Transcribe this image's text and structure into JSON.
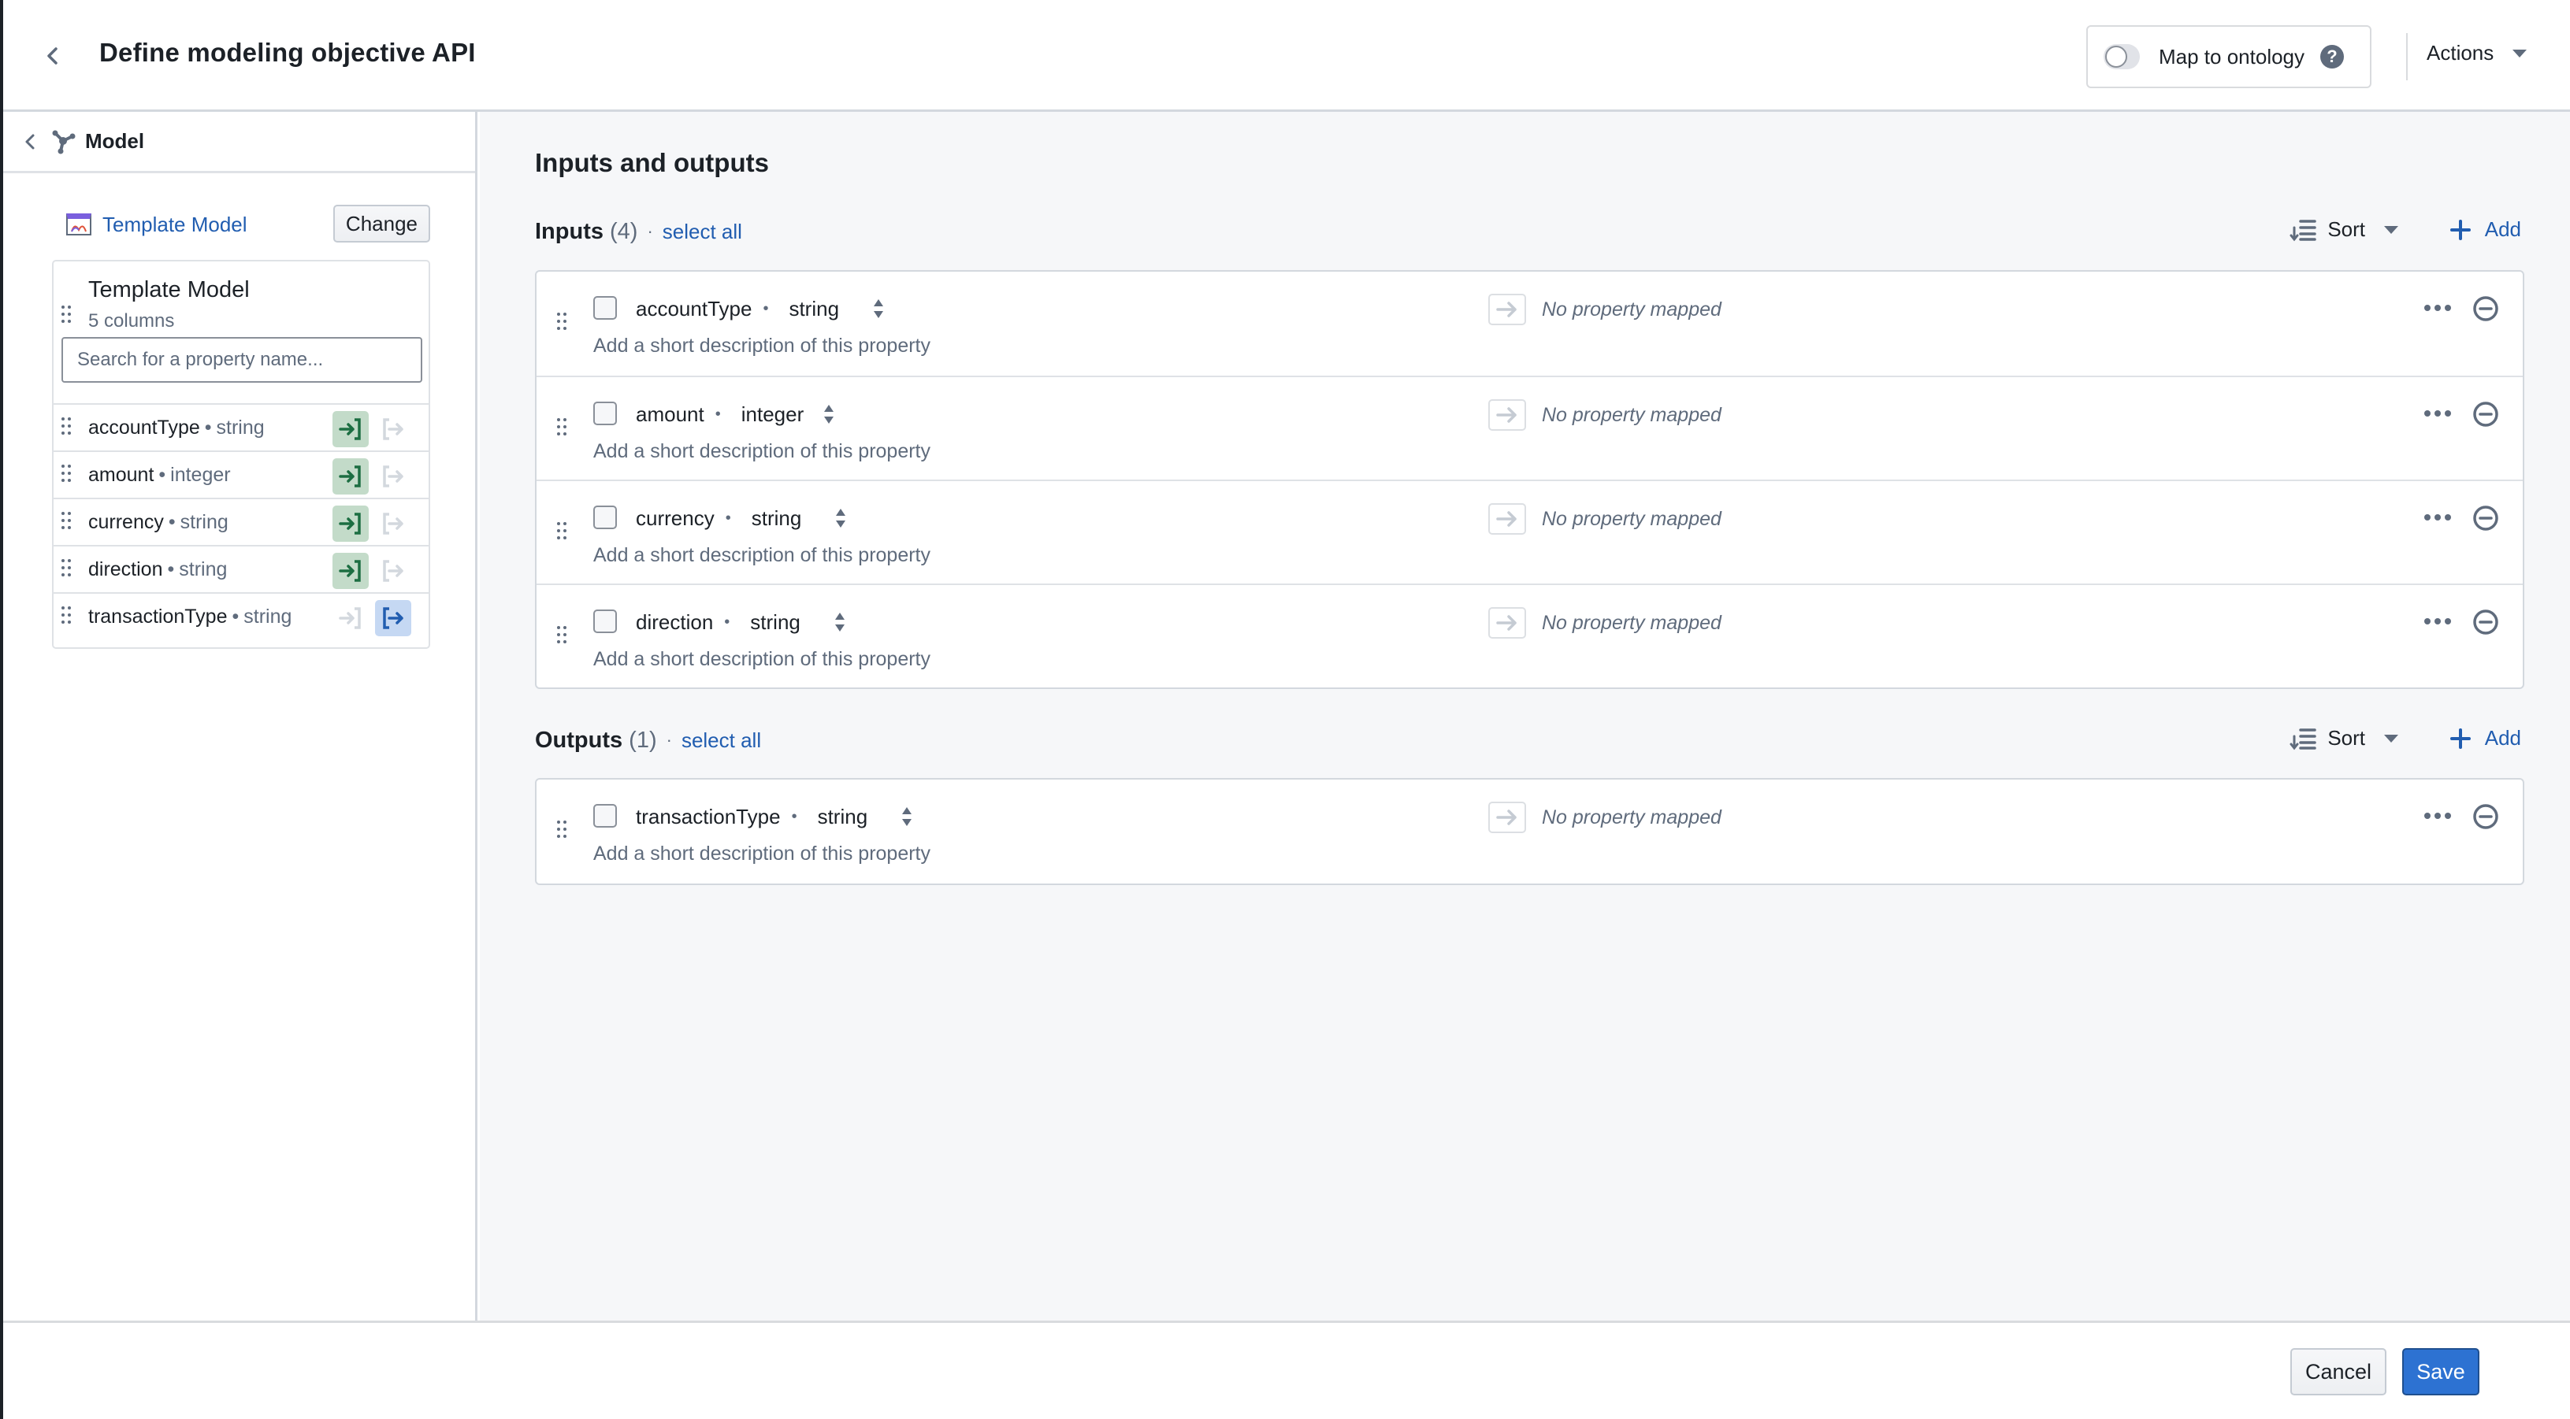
{
  "header": {
    "title": "Define modeling objective API",
    "back_icon": "chevron-left-icon",
    "map_to_ontology": {
      "label": "Map to ontology",
      "enabled": false,
      "help_icon": "question-mark-icon"
    },
    "actions_label": "Actions"
  },
  "sidebar": {
    "header_label": "Model",
    "header_icon": "model-graph-icon",
    "template": {
      "link_label": "Template Model",
      "change_label": "Change"
    },
    "model_card": {
      "title": "Template Model",
      "subtitle": "5 columns",
      "search_placeholder": "Search for a property name...",
      "properties": [
        {
          "name": "accountType",
          "type": "string",
          "role": "input"
        },
        {
          "name": "amount",
          "type": "integer",
          "role": "input"
        },
        {
          "name": "currency",
          "type": "string",
          "role": "input"
        },
        {
          "name": "direction",
          "type": "string",
          "role": "input"
        },
        {
          "name": "transactionType",
          "type": "string",
          "role": "output"
        }
      ]
    }
  },
  "main": {
    "title": "Inputs and outputs",
    "inputs": {
      "label": "Inputs",
      "count": "(4)",
      "separator": "·",
      "select_all": "select all",
      "sort_label": "Sort",
      "add_label": "Add",
      "rows": [
        {
          "name": "accountType",
          "type": "string",
          "description_placeholder": "Add a short description of this property",
          "mapping": "No property mapped"
        },
        {
          "name": "amount",
          "type": "integer",
          "description_placeholder": "Add a short description of this property",
          "mapping": "No property mapped"
        },
        {
          "name": "currency",
          "type": "string",
          "description_placeholder": "Add a short description of this property",
          "mapping": "No property mapped"
        },
        {
          "name": "direction",
          "type": "string",
          "description_placeholder": "Add a short description of this property",
          "mapping": "No property mapped"
        }
      ]
    },
    "outputs": {
      "label": "Outputs",
      "count": "(1)",
      "separator": "·",
      "select_all": "select all",
      "sort_label": "Sort",
      "add_label": "Add",
      "rows": [
        {
          "name": "transactionType",
          "type": "string",
          "description_placeholder": "Add a short description of this property",
          "mapping": "No property mapped"
        }
      ]
    }
  },
  "footer": {
    "cancel_label": "Cancel",
    "save_label": "Save"
  },
  "colors": {
    "accent_blue": "#2d72d2",
    "link_blue": "#215db0",
    "input_green_bg": "#c3dbc9",
    "input_green": "#1c6e42",
    "output_blue_bg": "#c5d8f3",
    "output_blue": "#215db0",
    "muted_gray": "#5f6b7c"
  }
}
